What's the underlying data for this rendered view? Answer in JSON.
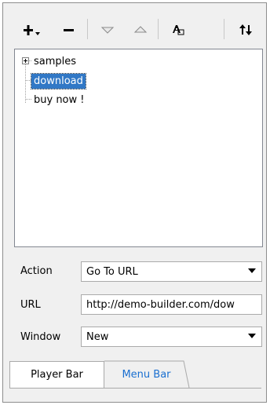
{
  "toolbar": {
    "add_icon": "plus-with-dropdown",
    "remove_icon": "minus",
    "move_down_icon": "triangle-down",
    "move_up_icon": "triangle-up",
    "rename_icon": "text-edit",
    "sort_icon": "up-down-arrows"
  },
  "tree": {
    "items": [
      {
        "label": "samples",
        "expandable": true,
        "selected": false
      },
      {
        "label": "download",
        "expandable": false,
        "selected": true
      },
      {
        "label": "buy now !",
        "expandable": false,
        "selected": false
      }
    ]
  },
  "form": {
    "action": {
      "label": "Action",
      "value": "Go To URL"
    },
    "url": {
      "label": "URL",
      "value": "http://demo-builder.com/dow"
    },
    "window": {
      "label": "Window",
      "value": "New"
    }
  },
  "tabs": [
    {
      "label": "Player Bar",
      "active": true
    },
    {
      "label": "Menu Bar",
      "active": false
    }
  ],
  "colors": {
    "selection": "#3178c6",
    "inactive_tab_text": "#1a6fd0"
  }
}
